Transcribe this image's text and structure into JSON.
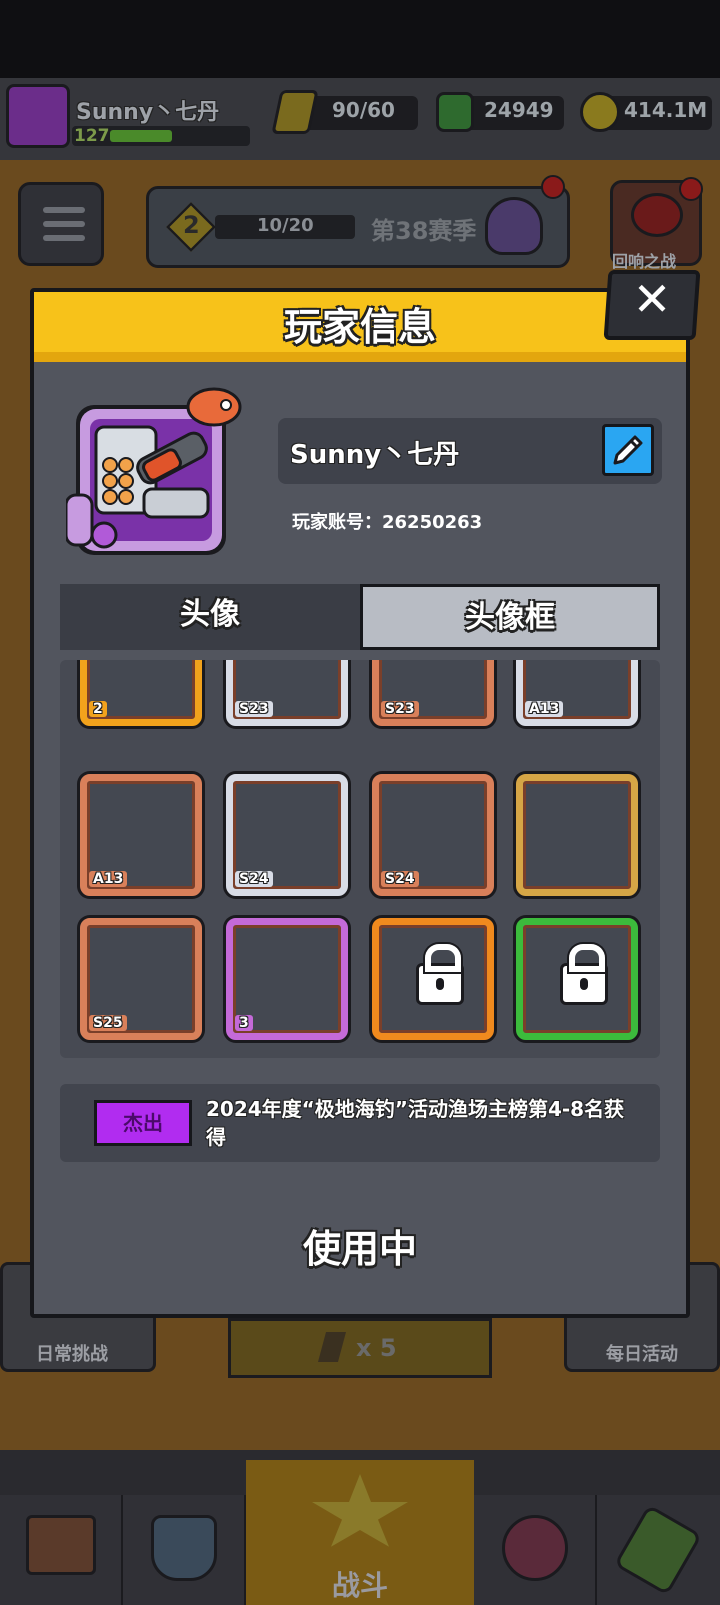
{
  "header": {
    "player_name": "Sunny丶七丹",
    "level": "127",
    "energy": "90/60",
    "gems": "24949",
    "coins": "414.1M"
  },
  "season": {
    "level": "2",
    "progress": "10/20",
    "progress_fraction": 0.5,
    "name": "第38赛季"
  },
  "event_button": "回响之战",
  "bottom": {
    "daily_challenge": "日常挑战",
    "energy_cost": "x 5",
    "daily_activity": "每日活动",
    "battle": "战斗"
  },
  "modal": {
    "title": "玩家信息",
    "close": "✕",
    "name": "Sunny丶七丹",
    "account": "玩家账号：26250263",
    "tabs": [
      "头像",
      "头像框"
    ],
    "selected_tab": "头像框",
    "frames": [
      {
        "tag": "2",
        "color": "#f2a21c",
        "locked": false
      },
      {
        "tag": "S23",
        "color": "#d8dce6",
        "locked": false
      },
      {
        "tag": "S23",
        "color": "#d9805a",
        "locked": false
      },
      {
        "tag": "A13",
        "color": "#d8dce6",
        "locked": false
      },
      {
        "tag": "A13",
        "color": "#d9805a",
        "locked": false
      },
      {
        "tag": "S24",
        "color": "#d8dce6",
        "locked": false
      },
      {
        "tag": "S24",
        "color": "#d9805a",
        "locked": false
      },
      {
        "tag": "",
        "color": "#d6a646",
        "locked": false
      },
      {
        "tag": "S25",
        "color": "#d9805a",
        "locked": false
      },
      {
        "tag": "3",
        "color": "#c46ad8",
        "locked": false
      },
      {
        "tag": "",
        "color": "#f08a1e",
        "locked": true
      },
      {
        "tag": "",
        "color": "#3cbb3c",
        "locked": true
      }
    ],
    "rarity": "杰出",
    "description": "2024年度“极地海钓”活动渔场主榜第4-8名获得",
    "status": "使用中"
  }
}
